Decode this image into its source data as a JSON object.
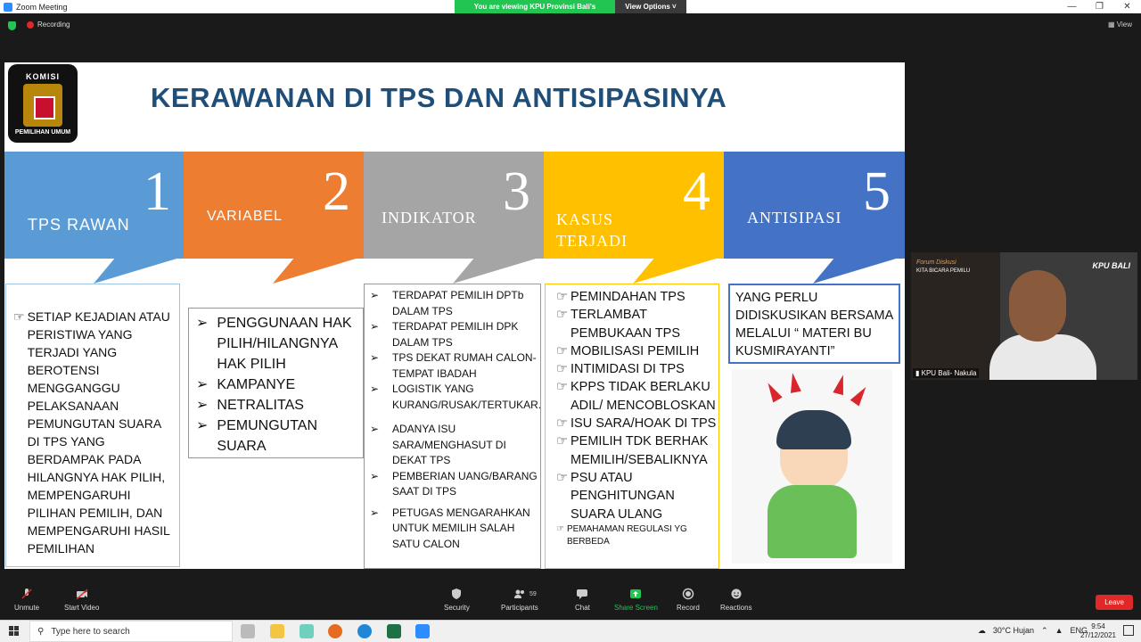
{
  "window": {
    "title": "Zoom Meeting",
    "share_banner": "You are viewing KPU Provinsi Bali's screen",
    "view_options": "View Options ˅",
    "controls": [
      "—",
      "❐",
      "✕"
    ]
  },
  "meeting_top": {
    "recording": "Recording",
    "view": "View"
  },
  "slide": {
    "title": "KERAWANAN DI TPS DAN ANTISIPASINYA",
    "logo_top": "KOMISI",
    "logo_bottom": "PEMILIHAN UMUM",
    "tabs": [
      {
        "num": "1",
        "label": "TPS RAWAN",
        "color": "#5b9bd5"
      },
      {
        "num": "2",
        "label": "VARIABEL",
        "color": "#ed7d31"
      },
      {
        "num": "3",
        "label": "INDIKATOR",
        "color": "#a5a5a5"
      },
      {
        "num": "4",
        "label": "KASUS TERJADI",
        "color": "#ffc000"
      },
      {
        "num": "5",
        "label": "ANTISIPASI",
        "color": "#4472c4"
      }
    ],
    "col1": {
      "bullet": "☞",
      "text": "SETIAP KEJADIAN ATAU PERISTIWA YANG TERJADI YANG BEROTENSI MENGGANGGU PELAKSANAAN PEMUNGUTAN SUARA DI TPS YANG BERDAMPAK PADA HILANGNYA HAK PILIH, MEMPENGARUHI PILIHAN PEMILIH, DAN MEMPENGARUHI HASIL PEMILIHAN"
    },
    "col2": {
      "bullet": "➢",
      "items": [
        "PENGGUNAAN HAK PILIH/HILANGNYA HAK PILIH",
        "KAMPANYE",
        "NETRALITAS",
        "PEMUNGUTAN SUARA"
      ]
    },
    "col3": {
      "bullet": "➢",
      "items": [
        "TERDAPAT PEMILIH DPTb DALAM TPS",
        "TERDAPAT PEMILIH DPK DALAM TPS",
        "TPS DEKAT RUMAH CALON- TEMPAT IBADAH",
        "LOGISTIK YANG KURANG/RUSAK/TERTUKAR.",
        "ADANYA ISU SARA/MENGHASUT DI DEKAT TPS",
        "PEMBERIAN UANG/BARANG SAAT DI TPS",
        "PETUGAS MENGARAHKAN UNTUK MEMILIH SALAH SATU CALON"
      ]
    },
    "col4": {
      "bullet": "☞",
      "items": [
        "PEMINDAHAN TPS",
        "TERLAMBAT PEMBUKAAN TPS",
        "MOBILISASI PEMILIH",
        "INTIMIDASI DI TPS",
        "KPPS TIDAK BERLAKU ADIL/ MENCOBLOSKAN",
        "ISU SARA/HOAK DI TPS",
        "PEMILIH TDK BERHAK MEMILIH/SEBALIKNYA",
        "PSU ATAU PENGHITUNGAN SUARA ULANG",
        "PEMAHAMAN REGULASI YG BERBEDA"
      ]
    },
    "col5": {
      "text": "YANG PERLU DIDISKUSIKAN BERSAMA MELALUI “ MATERI BU KUSMIRAYANTI”"
    }
  },
  "video": {
    "banner_title": "Forum Diskusi",
    "banner_sub": "KITA BICARA PEMILU",
    "brand": "KPU BALI",
    "name": "KPU Bali- Nakula"
  },
  "toolbar": {
    "items": [
      {
        "label": "Unmute",
        "icon": "mic-muted-icon"
      },
      {
        "label": "Start Video",
        "icon": "video-off-icon"
      },
      {
        "label": "Security",
        "icon": "shield-icon"
      },
      {
        "label": "Participants",
        "icon": "participants-icon"
      },
      {
        "label": "Chat",
        "icon": "chat-icon"
      },
      {
        "label": "Share Screen",
        "icon": "share-screen-icon"
      },
      {
        "label": "Record",
        "icon": "record-icon"
      },
      {
        "label": "Reactions",
        "icon": "reactions-icon"
      }
    ],
    "participants_count": "59",
    "leave": "Leave"
  },
  "taskbar": {
    "search_placeholder": "Type here to search",
    "weather": "30°C  Hujan",
    "lang": "ENG",
    "time": "9:54",
    "date": "27/12/2021"
  }
}
